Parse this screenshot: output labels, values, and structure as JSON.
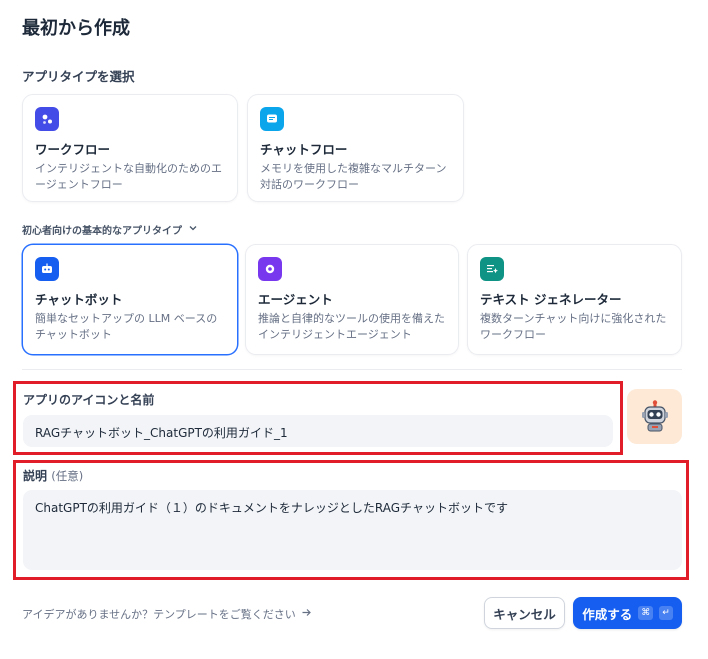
{
  "header": {
    "title": "最初から作成"
  },
  "app_type": {
    "label": "アプリタイプを選択",
    "primary": [
      {
        "icon": "workflow-icon",
        "icon_bg": "#444ce7",
        "title": "ワークフロー",
        "desc": "インテリジェントな自動化のためのエージェントフロー"
      },
      {
        "icon": "chatflow-icon",
        "icon_bg": "#0ba5ec",
        "title": "チャットフロー",
        "desc": "メモリを使用した複雑なマルチターン対話のワークフロー"
      }
    ],
    "beginner_label": "初心者向けの基本的なアプリタイプ",
    "basic": [
      {
        "icon": "chatbot-icon",
        "icon_bg": "#155eef",
        "title": "チャットボット",
        "desc": "簡単なセットアップの LLM ベースのチャットボット",
        "selected": true
      },
      {
        "icon": "agent-icon",
        "icon_bg": "#7839ee",
        "title": "エージェント",
        "desc": "推論と自律的なツールの使用を備えたインテリジェントエージェント",
        "selected": false
      },
      {
        "icon": "text-generator-icon",
        "icon_bg": "#0e9384",
        "title": "テキスト ジェネレーター",
        "desc": "複数ターンチャット向けに強化されたワークフロー",
        "selected": false
      }
    ]
  },
  "name_field": {
    "label": "アプリのアイコンと名前",
    "value": "RAGチャットボット_ChatGPTの利用ガイド_1"
  },
  "avatar": {
    "icon": "robot-avatar-icon",
    "bg": "#fde9d6"
  },
  "description_field": {
    "label": "説明",
    "optional": "(任意)",
    "value": "ChatGPTの利用ガイド（１）のドキュメントをナレッジとしたRAGチャットボットです"
  },
  "footer": {
    "template_link": "アイデアがありませんか？テンプレートをご覧ください",
    "cancel_label": "キャンセル",
    "create_label": "作成する",
    "shortcut_cmd": "⌘",
    "shortcut_enter": "↵"
  },
  "colors": {
    "accent": "#155eef",
    "highlight": "#e11d2a",
    "input_bg": "#f2f4f7"
  }
}
